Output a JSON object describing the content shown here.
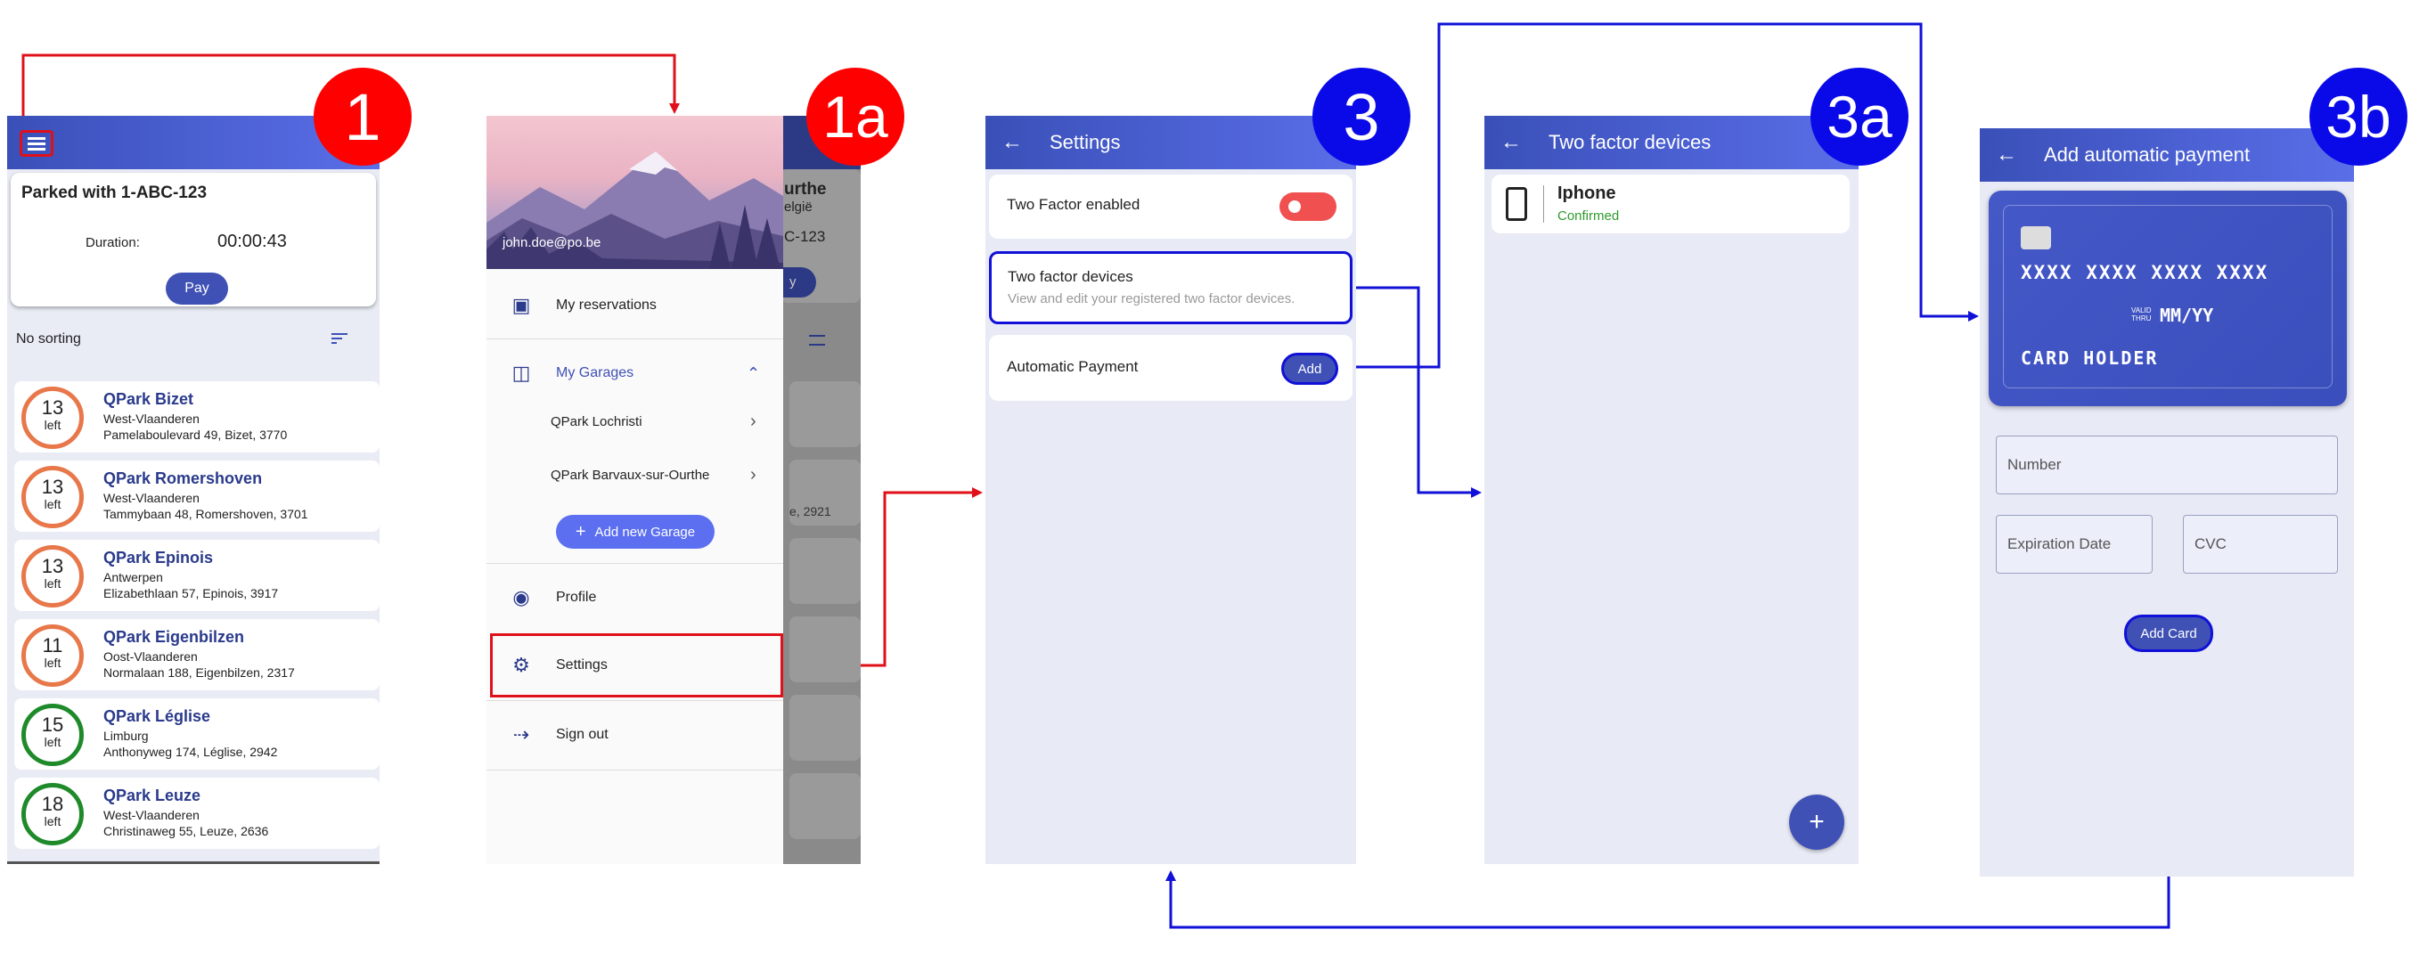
{
  "badges": {
    "s1": "1",
    "s1a": "1a",
    "s3": "3",
    "s3a": "3a",
    "s3b": "3b"
  },
  "screen1": {
    "parked_title": "Parked with 1-ABC-123",
    "duration_label": "Duration:",
    "duration_value": "00:00:43",
    "pay_label": "Pay",
    "sorting_label": "No sorting",
    "garages": [
      {
        "count": "13",
        "left": "left",
        "name": "QPark Bizet",
        "region": "West-Vlaanderen",
        "address": "Pamelaboulevard 49, Bizet, 3770",
        "ring": "#e8774a"
      },
      {
        "count": "13",
        "left": "left",
        "name": "QPark Romershoven",
        "region": "West-Vlaanderen",
        "address": "Tammybaan 48, Romershoven, 3701",
        "ring": "#e8774a"
      },
      {
        "count": "13",
        "left": "left",
        "name": "QPark Epinois",
        "region": "Antwerpen",
        "address": "Elizabethlaan 57, Epinois, 3917",
        "ring": "#e8774a"
      },
      {
        "count": "11",
        "left": "left",
        "name": "QPark Eigenbilzen",
        "region": "Oost-Vlaanderen",
        "address": "Normalaan 188, Eigenbilzen, 2317",
        "ring": "#e8774a"
      },
      {
        "count": "15",
        "left": "left",
        "name": "QPark Léglise",
        "region": "Limburg",
        "address": "Anthonyweg 174, Léglise, 2942",
        "ring": "#1e8a2a"
      },
      {
        "count": "18",
        "left": "left",
        "name": "QPark Leuze",
        "region": "West-Vlaanderen",
        "address": "Christinaweg 55, Leuze, 2636",
        "ring": "#1e8a2a"
      }
    ]
  },
  "screen1a": {
    "email": "john.doe@po.be",
    "bg_title": "urthe",
    "bg_sub": "elgië",
    "bg_plate": "C-123",
    "bg_pay": "y",
    "bg_addr": "e, 2921",
    "items": {
      "reservations": "My reservations",
      "garages": "My Garages",
      "lochristi": "QPark Lochristi",
      "barvaux": "QPark Barvaux-sur-Ourthe",
      "add_garage": "Add new Garage",
      "profile": "Profile",
      "settings": "Settings",
      "signout": "Sign out"
    }
  },
  "screen3": {
    "title": "Settings",
    "two_factor_enabled": "Two Factor enabled",
    "two_factor_devices": "Two factor devices",
    "two_factor_devices_sub": "View and edit your registered two factor devices.",
    "auto_payment": "Automatic Payment",
    "add_label": "Add"
  },
  "screen3a": {
    "title": "Two factor devices",
    "device_name": "Iphone",
    "device_status": "Confirmed",
    "fab": "+"
  },
  "screen3b": {
    "title": "Add automatic payment",
    "card_number": "XXXX XXXX XXXX XXXX",
    "valid_thru_1": "VALID",
    "valid_thru_2": "THRU",
    "expiry": "MM/YY",
    "holder": "CARD HOLDER",
    "number_placeholder": "Number",
    "expiration_placeholder": "Expiration Date",
    "cvc_placeholder": "CVC",
    "add_card": "Add Card"
  },
  "colors": {
    "red_arrow": "#e0101a",
    "blue_arrow": "#1010d8",
    "primary": "#3f51b5"
  }
}
